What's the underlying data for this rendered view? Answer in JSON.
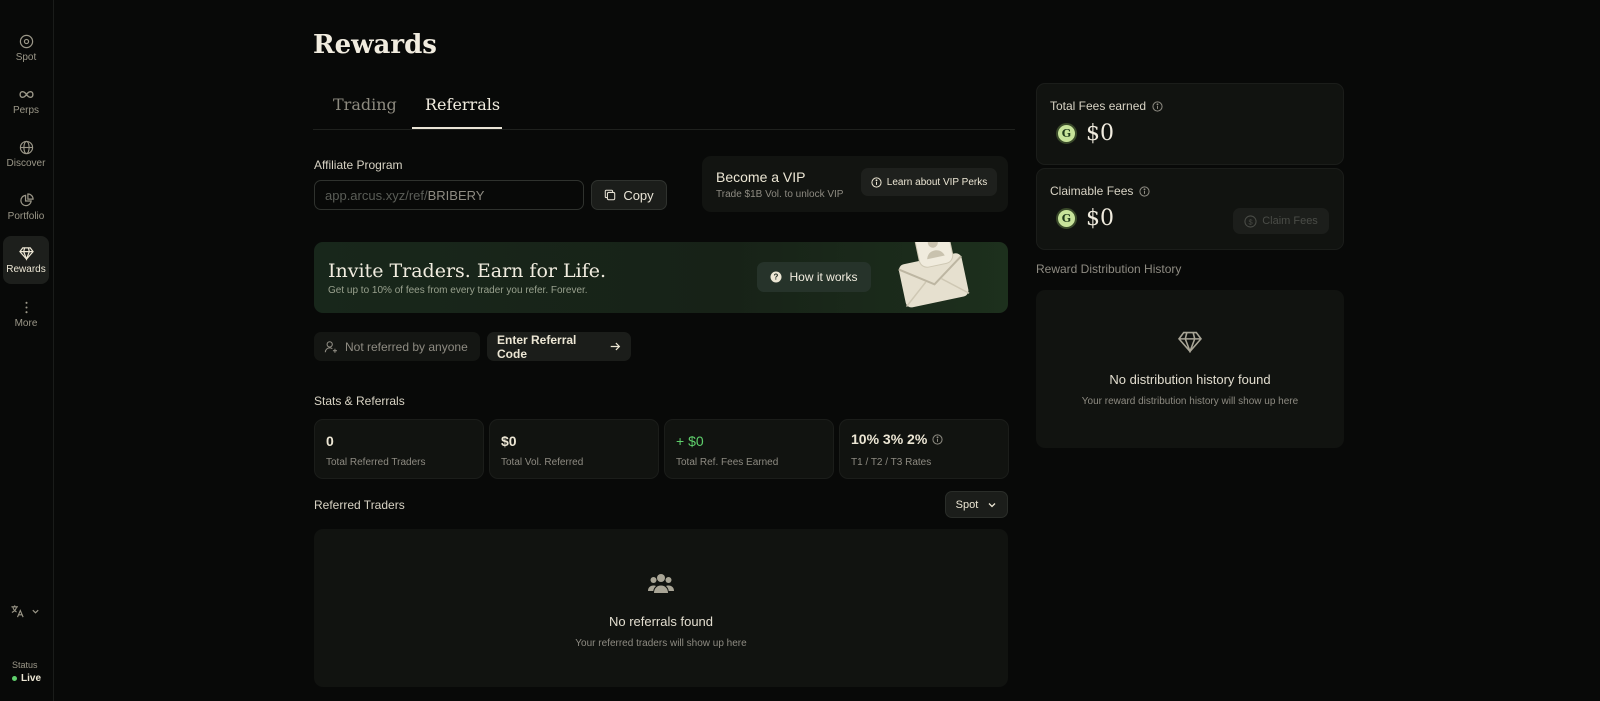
{
  "sidebar": {
    "items": [
      {
        "label": "Spot",
        "icon": "spot-icon"
      },
      {
        "label": "Perps",
        "icon": "infinity-icon"
      },
      {
        "label": "Discover",
        "icon": "globe-icon"
      },
      {
        "label": "Portfolio",
        "icon": "pie-chart-icon"
      },
      {
        "label": "Rewards",
        "icon": "diamond-icon"
      },
      {
        "label": "More",
        "icon": "more-vertical-icon"
      }
    ],
    "status_label": "Status",
    "status_value": "Live"
  },
  "page": {
    "title": "Rewards",
    "tabs": [
      {
        "label": "Trading"
      },
      {
        "label": "Referrals"
      }
    ],
    "active_tab": "Referrals"
  },
  "affiliate": {
    "label": "Affiliate Program",
    "link_prefix": "app.arcus.xyz/ref/",
    "code": "BRIBERY",
    "copy_label": "Copy"
  },
  "vip": {
    "title": "Become a VIP",
    "subtitle": "Trade $1B Vol. to unlock VIP",
    "button_label": "Learn about VIP Perks"
  },
  "banner": {
    "headline": "Invite Traders. Earn for Life.",
    "subtext": "Get up to 10% of fees from every trader you refer. Forever.",
    "button_label": "How it works"
  },
  "referral_status": {
    "not_referred": "Not referred by anyone",
    "enter_code": "Enter Referral Code"
  },
  "stats": {
    "section_label": "Stats & Referrals",
    "cards": [
      {
        "value": "0",
        "label": "Total Referred Traders"
      },
      {
        "value": "$0",
        "label": "Total Vol. Referred"
      },
      {
        "value": "+ $0",
        "label": "Total Ref. Fees Earned"
      },
      {
        "value": "10% 3% 2%",
        "label": "T1 / T2 / T3 Rates"
      }
    ]
  },
  "referred_traders": {
    "label": "Referred Traders",
    "filter": "Spot",
    "empty_title": "No referrals found",
    "empty_subtitle": "Your referred traders will show up here"
  },
  "fees": {
    "total_label": "Total Fees earned",
    "total_value": "$0",
    "claimable_label": "Claimable Fees",
    "claimable_value": "$0",
    "claim_button": "Claim Fees"
  },
  "distribution": {
    "label": "Reward Distribution History",
    "empty_title": "No distribution history found",
    "empty_subtitle": "Your reward distribution history will show up here"
  },
  "colors": {
    "background": "#080908",
    "accent_green": "#5fcf6c",
    "text_primary": "#ece6d4",
    "text_muted": "#8e8b82"
  }
}
